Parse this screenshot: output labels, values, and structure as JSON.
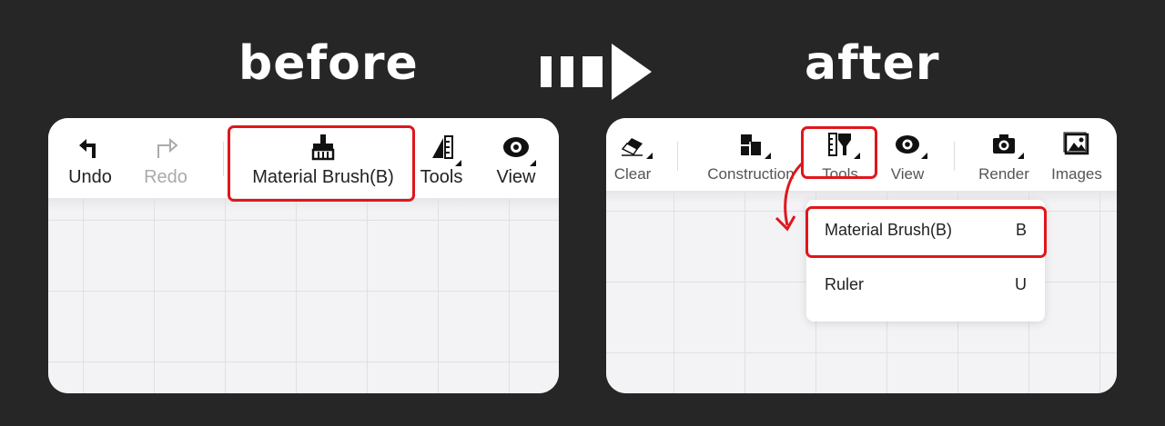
{
  "headings": {
    "before": "before",
    "after": "after"
  },
  "before": {
    "toolbar": {
      "undo": "Undo",
      "redo": "Redo",
      "material_brush": "Material Brush(B)",
      "tools": "Tools",
      "view": "View"
    }
  },
  "after": {
    "toolbar": {
      "clear": "Clear",
      "construction": "Construction",
      "tools": "Tools",
      "view": "View",
      "render": "Render",
      "images": "Images"
    },
    "tools_menu": {
      "items": [
        {
          "label": "Material Brush(B)",
          "shortcut": "B"
        },
        {
          "label": "Ruler",
          "shortcut": "U"
        }
      ]
    }
  },
  "colors": {
    "highlight": "#e0161c",
    "background": "#262626",
    "panel": "#ffffff"
  }
}
